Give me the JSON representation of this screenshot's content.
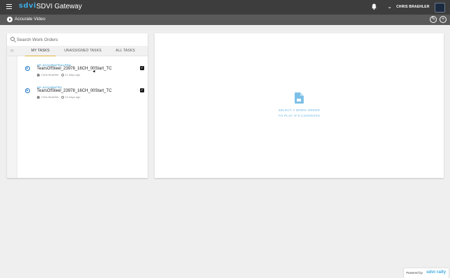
{
  "header": {
    "logo": "sdvi",
    "title": "SDVI Gateway",
    "username": "CHRIS BRAEHLER"
  },
  "subbar": {
    "title": "Accurate Video",
    "edit_icon": "pencil-icon",
    "add_icon": "plus-icon"
  },
  "search": {
    "placeholder": "Search Work Orders"
  },
  "tabs": [
    {
      "label": "MY TASKS",
      "active": true
    },
    {
      "label": "UNASSIGNED TASKS",
      "active": false
    },
    {
      "label": "ALL TASKS",
      "active": false
    }
  ],
  "work_orders": [
    {
      "queue": "AP-ACCURATEALPHA",
      "name": "TearsOfSteel_23978_16CH_00Start_TC",
      "user": "Chris Braehler",
      "age": "11 days ago",
      "checked": true
    },
    {
      "queue": "AP-ACCURATE2",
      "name": "TearsOfSteel_23978_16CH_00Start_TC",
      "user": "Chris Braehler",
      "age": "10 days ago",
      "checked": true
    }
  ],
  "placeholder": {
    "line1": "SELECT A WORK ORDER",
    "line2": "TO PLAY IT'S CONTENTS"
  },
  "footer": {
    "powered_by": "Powered by",
    "brand": "sdvi rally"
  },
  "colors": {
    "topbar": "#3d3d3d",
    "subbar": "#5a5a5a",
    "accent": "#3fa8e0",
    "active_tab": "#e2b33b",
    "radio": "#1a73c8"
  }
}
